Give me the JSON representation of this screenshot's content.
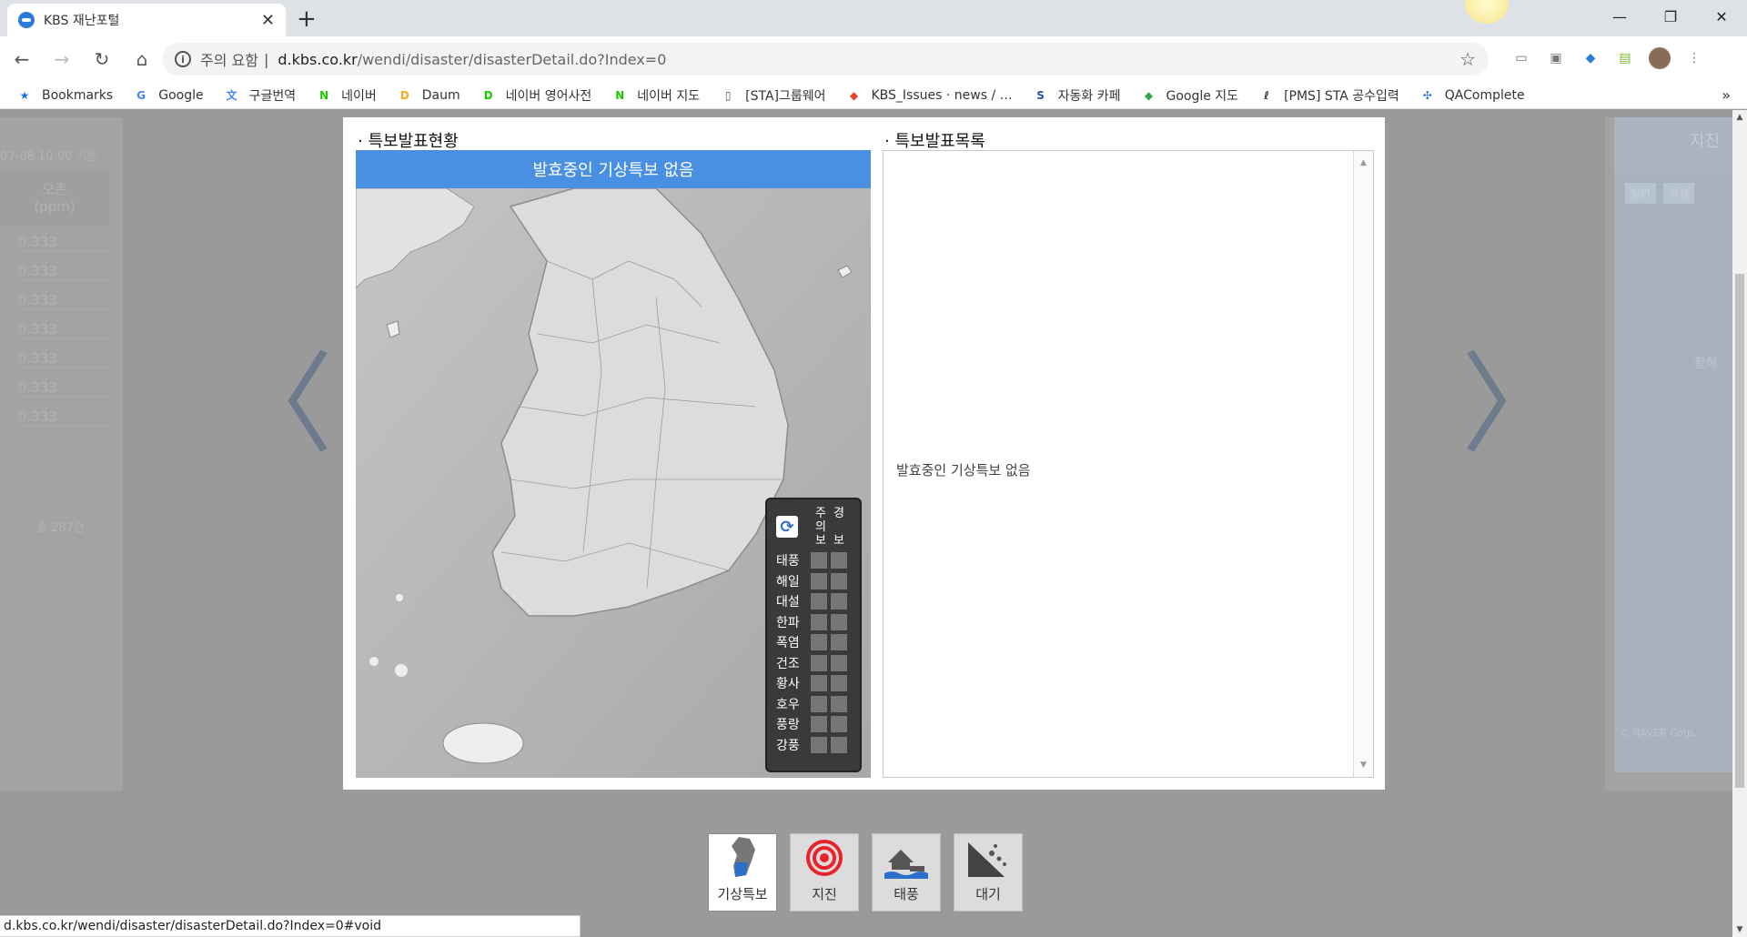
{
  "browser": {
    "tab_title": "KBS 재난포털",
    "tab_close": "✕",
    "new_tab": "+",
    "window_controls": [
      "—",
      "❐",
      "✕"
    ],
    "nav": {
      "back": "←",
      "forward": "→",
      "reload": "↻",
      "home": "⌂"
    },
    "omnibox": {
      "info": "i",
      "security_label": "주의 요함",
      "separator": "|",
      "host": "d.kbs.co.kr",
      "path": "/wendi/disaster/disasterDetail.do?Index=0",
      "star": "☆"
    },
    "menu": "⋮"
  },
  "bookmarks": [
    {
      "label": "Bookmarks",
      "icon": "star-icon",
      "glyph": "★",
      "color": "#1a73e8"
    },
    {
      "label": "Google",
      "icon": "google-icon",
      "glyph": "G",
      "color": "#4285f4"
    },
    {
      "label": "구글번역",
      "icon": "translate-icon",
      "glyph": "文",
      "color": "#4285f4"
    },
    {
      "label": "네이버",
      "icon": "naver-icon",
      "glyph": "N",
      "color": "#1ec800"
    },
    {
      "label": "Daum",
      "icon": "daum-icon",
      "glyph": "D",
      "color": "#f5a623"
    },
    {
      "label": "네이버 영어사전",
      "icon": "dict-icon",
      "glyph": "D",
      "color": "#1ec800"
    },
    {
      "label": "네이버 지도",
      "icon": "naver-map-icon",
      "glyph": "N",
      "color": "#1ec800"
    },
    {
      "label": "[STA]그룹웨어",
      "icon": "page-icon",
      "glyph": "▯",
      "color": "#555555"
    },
    {
      "label": "KBS_Issues · news / …",
      "icon": "gitlab-icon",
      "glyph": "◆",
      "color": "#e24329"
    },
    {
      "label": "자동화 카페",
      "icon": "sta-icon",
      "glyph": "S",
      "color": "#2b4fa3"
    },
    {
      "label": "Google 지도",
      "icon": "google-maps-icon",
      "glyph": "◆",
      "color": "#34a853"
    },
    {
      "label": "[PMS] STA 공수입력",
      "icon": "pms-icon",
      "glyph": "ℓ",
      "color": "#333333"
    },
    {
      "label": "QAComplete",
      "icon": "qacomplete-icon",
      "glyph": "✣",
      "color": "#2b6fc8"
    }
  ],
  "bookmarks_more": "»",
  "page": {
    "prev_arrow": "〈",
    "next_arrow": "〉",
    "ghost_left": {
      "time": "07-08 10:00 기준",
      "col_header": "오존\n(ppm)",
      "values": [
        "0.333",
        "0.333",
        "0.333",
        "0.333",
        "0.333",
        "0.333",
        "0.333"
      ],
      "total": "총 287건"
    },
    "ghost_right": {
      "title": "지진",
      "tabs": [
        "일반",
        "위성"
      ],
      "label": "황해",
      "credit": "© NAVER Corp."
    },
    "status_title": "· 특보발표현황",
    "list_title": "· 특보발표목록",
    "map_header": "발효중인 기상특보 없음",
    "list_empty": "발효중인 기상특보 없음",
    "legend": {
      "col_caution": "주의보",
      "col_warning": "경보",
      "items": [
        "태풍",
        "해일",
        "대설",
        "한파",
        "폭염",
        "건조",
        "황사",
        "호우",
        "풍랑",
        "강풍"
      ]
    },
    "menu": [
      {
        "label": "기상특보",
        "icon": "korea-map-icon",
        "active": true
      },
      {
        "label": "지진",
        "icon": "earthquake-icon",
        "active": false
      },
      {
        "label": "태풍",
        "icon": "flood-house-icon",
        "active": false
      },
      {
        "label": "대기",
        "icon": "landslide-icon",
        "active": false
      }
    ],
    "status_url": "d.kbs.co.kr/wendi/disaster/disasterDetail.do?Index=0#void"
  },
  "colors": {
    "accent_blue": "#4a90e2",
    "overlay_gray": "#9a9a9a",
    "legend_bg": "#3a3a3a"
  }
}
